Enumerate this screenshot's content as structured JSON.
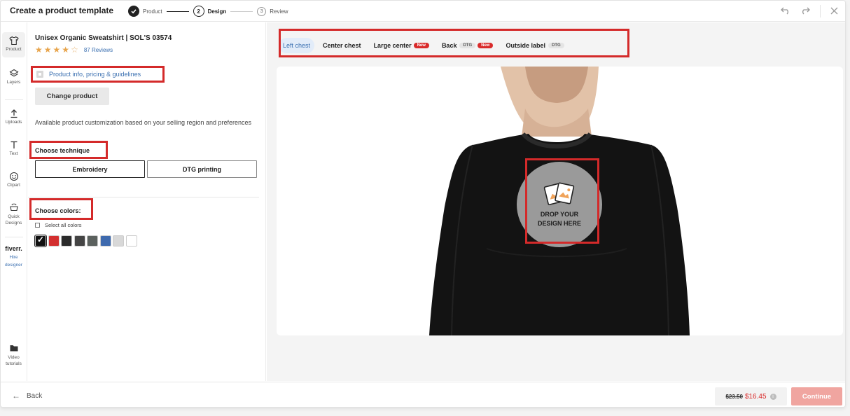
{
  "header": {
    "title": "Create a product template",
    "steps": [
      {
        "number": "",
        "label": "Product",
        "state": "done"
      },
      {
        "number": "2",
        "label": "Design",
        "state": "current"
      },
      {
        "number": "3",
        "label": "Review",
        "state": "todo"
      }
    ],
    "icons": [
      "undo-icon",
      "redo-icon",
      "close-icon"
    ]
  },
  "rail": {
    "items": [
      {
        "label": "Product",
        "icon": "shirt-icon"
      },
      {
        "label": "Layers",
        "icon": "layers-icon"
      },
      {
        "label": "Uploads",
        "icon": "upload-icon"
      },
      {
        "label": "Text",
        "icon": "text-icon"
      },
      {
        "label": "Clipart",
        "icon": "smiley-icon"
      },
      {
        "label": "Quick",
        "label2": "Designs",
        "icon": "quick-designs-icon"
      },
      {
        "label": "fiverr.",
        "sub1": "Hire",
        "sub2": "designer"
      },
      {
        "label": "Video",
        "label2": "tutorials",
        "icon": "folder-icon"
      }
    ]
  },
  "panel": {
    "product_title": "Unisex Organic Sweatshirt | SOL'S 03574",
    "rating": 4.5,
    "reviews": "87 Reviews",
    "info_link": "Product info, pricing & guidelines",
    "change_button": "Change product",
    "availability": "Available product customization based on your selling region and preferences",
    "technique_title": "Choose technique",
    "techniques": [
      "Embroidery",
      "DTG printing"
    ],
    "colors_title": "Choose colors:",
    "select_all": "Select all colors",
    "colors": [
      "#111111",
      "#d32f2f",
      "#2b2b2b",
      "#444444",
      "#5b615e",
      "#3e6aae",
      "#d8d8d8",
      "#ffffff"
    ]
  },
  "placements": {
    "tabs": [
      {
        "label": "Left chest",
        "active": true
      },
      {
        "label": "Center chest"
      },
      {
        "label": "Large center",
        "badge": "New"
      },
      {
        "label": "Back",
        "tag": "DTG",
        "badge": "New"
      },
      {
        "label": "Outside label",
        "tag": "DTG"
      }
    ]
  },
  "canvas": {
    "drop_text": "DROP YOUR DESIGN HERE"
  },
  "footer": {
    "back": "Back",
    "old_price": "$23.50",
    "new_price": "$16.45",
    "continue": "Continue"
  },
  "colors": {
    "accent": "#3a6fb0",
    "brand_red": "#d92b2b",
    "highlight": "#d42a2a"
  }
}
